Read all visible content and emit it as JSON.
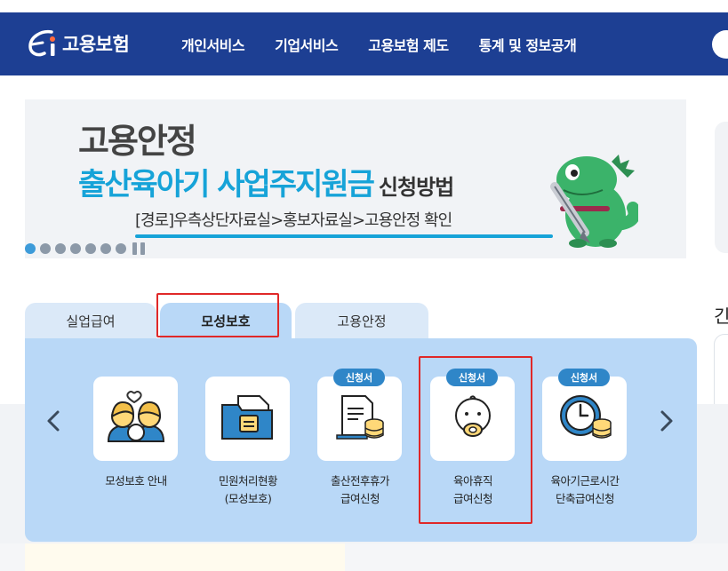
{
  "header": {
    "logo_text": "고용보험",
    "nav": [
      "개인서비스",
      "기업서비스",
      "고용보험 제도",
      "통계 및 정보공개"
    ]
  },
  "banner": {
    "title": "고용안정",
    "subtitle": "출산육아기 사업주지원금",
    "subtitle_suffix": "신청방법",
    "path": "[경로]우측상단자료실>홍보자료실>고용안정 확인",
    "slide_count": 7,
    "active_slide": 1
  },
  "right_partial": {
    "label": "긴"
  },
  "tabs": [
    {
      "label": "실업급여",
      "active": false
    },
    {
      "label": "모성보호",
      "active": true
    },
    {
      "label": "고용안정",
      "active": false
    }
  ],
  "services": [
    {
      "badge": "",
      "line1": "모성보호 안내",
      "line2": "",
      "icon": "family-icon"
    },
    {
      "badge": "",
      "line1": "민원처리현황",
      "line2": "(모성보호)",
      "icon": "folder-icon"
    },
    {
      "badge": "신청서",
      "line1": "출산전후휴가",
      "line2": "급여신청",
      "icon": "document-coins-icon"
    },
    {
      "badge": "신청서",
      "line1": "육아휴직",
      "line2": "급여신청",
      "icon": "baby-icon"
    },
    {
      "badge": "신청서",
      "line1": "육아기근로시간",
      "line2": "단축급여신청",
      "icon": "clock-coins-icon"
    }
  ],
  "colors": {
    "header_bg": "#1d3f93",
    "panel_bg": "#b9d8f7",
    "tab_bg": "#dbe9f8",
    "badge_bg": "#2f86c8",
    "highlight": "#e02828",
    "banner_accent": "#16a3d8"
  }
}
